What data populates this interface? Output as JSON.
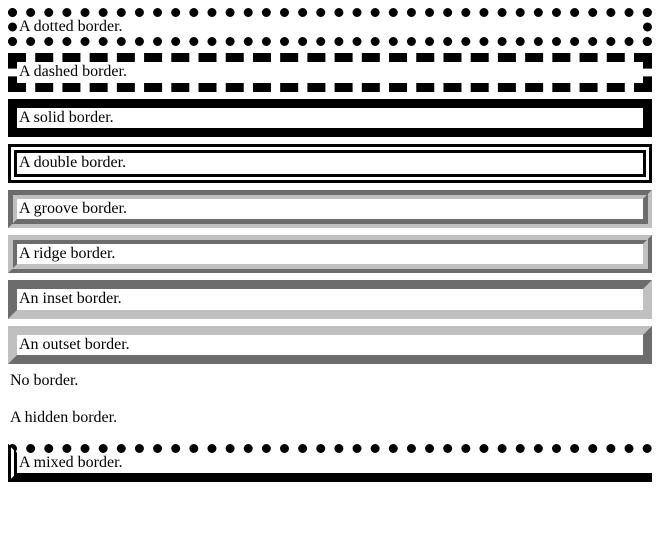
{
  "page": {
    "title": "Border style demo",
    "background_color": "#ffffff",
    "text_color": "#000000",
    "border_color_dark": "#000000",
    "border_color_3d": "#c0c0c0",
    "border_width": "9px"
  },
  "demos": [
    {
      "id": "dotted",
      "label": "A dotted border.",
      "border_style": "dotted",
      "border_color": "#000000"
    },
    {
      "id": "dashed",
      "label": "A dashed border.",
      "border_style": "dashed",
      "border_color": "#000000"
    },
    {
      "id": "solid",
      "label": "A solid border.",
      "border_style": "solid",
      "border_color": "#000000"
    },
    {
      "id": "double",
      "label": "A double border.",
      "border_style": "double",
      "border_color": "#000000"
    },
    {
      "id": "groove",
      "label": "A groove border.",
      "border_style": "groove",
      "border_color": "#c0c0c0"
    },
    {
      "id": "ridge",
      "label": "A ridge border.",
      "border_style": "ridge",
      "border_color": "#c0c0c0"
    },
    {
      "id": "inset",
      "label": "An inset border.",
      "border_style": "inset",
      "border_color": "#c0c0c0"
    },
    {
      "id": "outset",
      "label": "An outset border.",
      "border_style": "outset",
      "border_color": "#c0c0c0"
    },
    {
      "id": "none",
      "label": "No border.",
      "border_style": "none",
      "border_color": "#000000"
    },
    {
      "id": "hidden",
      "label": "A hidden border.",
      "border_style": "hidden",
      "border_color": "#000000"
    },
    {
      "id": "mixed",
      "label": "A mixed border.",
      "border_style": "dotted hidden solid double",
      "border_color": "#000000"
    }
  ]
}
